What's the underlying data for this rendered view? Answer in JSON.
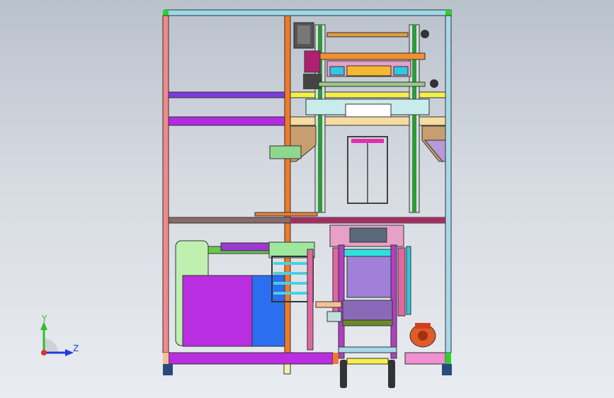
{
  "viewport": {
    "background_top": "#b9c1cb",
    "background_bottom": "#e9ecf0"
  },
  "model": {
    "description_icon": "machine-assembly-front-view"
  },
  "triad": {
    "y_label": "Y",
    "z_label": "Z",
    "y_color": "#2fbf2f",
    "z_color": "#1f3ce0",
    "origin_color": "#e03030"
  }
}
